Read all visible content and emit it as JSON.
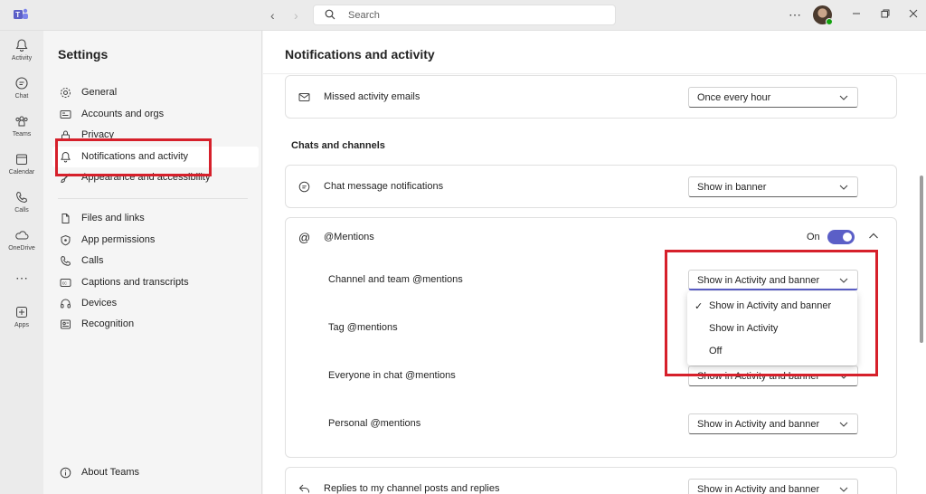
{
  "topbar": {
    "search_placeholder": "Search"
  },
  "rail": [
    {
      "label": "Activity",
      "icon": "bell-icon"
    },
    {
      "label": "Chat",
      "icon": "chat-icon"
    },
    {
      "label": "Teams",
      "icon": "teams-icon"
    },
    {
      "label": "Calendar",
      "icon": "calendar-icon"
    },
    {
      "label": "Calls",
      "icon": "phone-icon"
    },
    {
      "label": "OneDrive",
      "icon": "cloud-icon"
    },
    {
      "label": "Apps",
      "icon": "plus-icon"
    }
  ],
  "settings": {
    "title": "Settings",
    "items": [
      {
        "label": "General",
        "icon": "gear-icon"
      },
      {
        "label": "Accounts and orgs",
        "icon": "id-card-icon"
      },
      {
        "label": "Privacy",
        "icon": "lock-icon"
      },
      {
        "label": "Notifications and activity",
        "icon": "bell-icon",
        "active": true
      },
      {
        "label": "Appearance and accessibility",
        "icon": "brush-icon"
      },
      {
        "label": "Files and links",
        "icon": "file-icon"
      },
      {
        "label": "App permissions",
        "icon": "shield-icon"
      },
      {
        "label": "Calls",
        "icon": "phone-icon"
      },
      {
        "label": "Captions and transcripts",
        "icon": "cc-icon"
      },
      {
        "label": "Devices",
        "icon": "headset-icon"
      },
      {
        "label": "Recognition",
        "icon": "recognition-icon"
      }
    ],
    "about": "About Teams"
  },
  "main": {
    "title": "Notifications and activity",
    "missed_emails": {
      "label": "Missed activity emails",
      "value": "Once every hour"
    },
    "section_chats": "Chats and channels",
    "chat_message": {
      "label": "Chat message notifications",
      "value": "Show in banner"
    },
    "mentions": {
      "label": "@Mentions",
      "toggle_label": "On",
      "toggle_on": true,
      "rows": [
        {
          "label": "Channel and team @mentions",
          "value": "Show in Activity and banner"
        },
        {
          "label": "Tag @mentions",
          "value": ""
        },
        {
          "label": "Everyone in chat @mentions",
          "value": "Show in Activity and banner"
        },
        {
          "label": "Personal @mentions",
          "value": "Show in Activity and banner"
        }
      ]
    },
    "dropdown_menu": {
      "options": [
        "Show in Activity and banner",
        "Show in Activity",
        "Off"
      ],
      "selected_check": "✓"
    },
    "replies": {
      "label": "Replies to my channel posts and replies",
      "value": "Show in Activity and banner"
    }
  },
  "colors": {
    "accent": "#5b5fc7",
    "highlight": "#d6202b"
  }
}
